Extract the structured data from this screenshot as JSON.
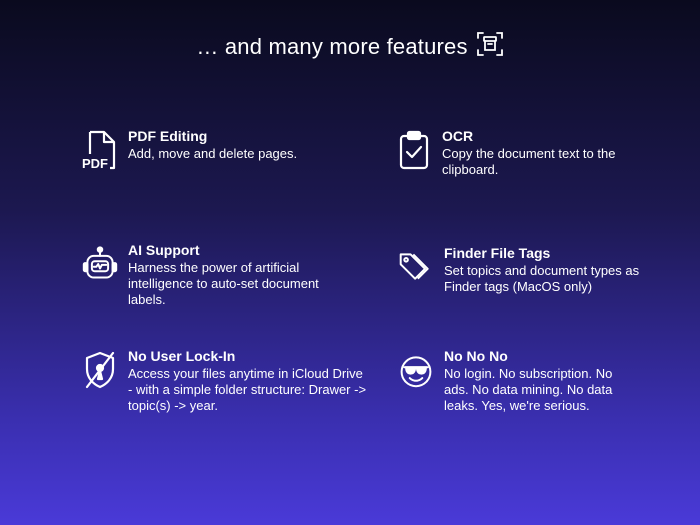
{
  "header": {
    "title": "… and many more features",
    "icon": "archive-scan-icon"
  },
  "features": [
    {
      "title": "PDF Editing",
      "description": "Add, move and delete pages.",
      "icon": "pdf-document-icon",
      "icon_text": "PDF"
    },
    {
      "title": "OCR",
      "description": "Copy the document text to the clipboard.",
      "icon": "clipboard-check-icon"
    },
    {
      "title": "AI Support",
      "description": "Harness the power of artificial intelligence to auto-set document labels.",
      "icon": "robot-icon"
    },
    {
      "title": "Finder File Tags",
      "description": "Set topics and document types as Finder tags (MacOS only)",
      "icon": "tags-icon"
    },
    {
      "title": "No User Lock-In",
      "description": "Access your files anytime in iCloud Drive - with a simple folder structure: Drawer -> topic(s) -> year.",
      "icon": "shield-slash-icon"
    },
    {
      "title": "No No No",
      "description": "No login. No subscription. No ads. No data mining. No data leaks. Yes, we're serious.",
      "icon": "sunglasses-face-icon"
    }
  ]
}
